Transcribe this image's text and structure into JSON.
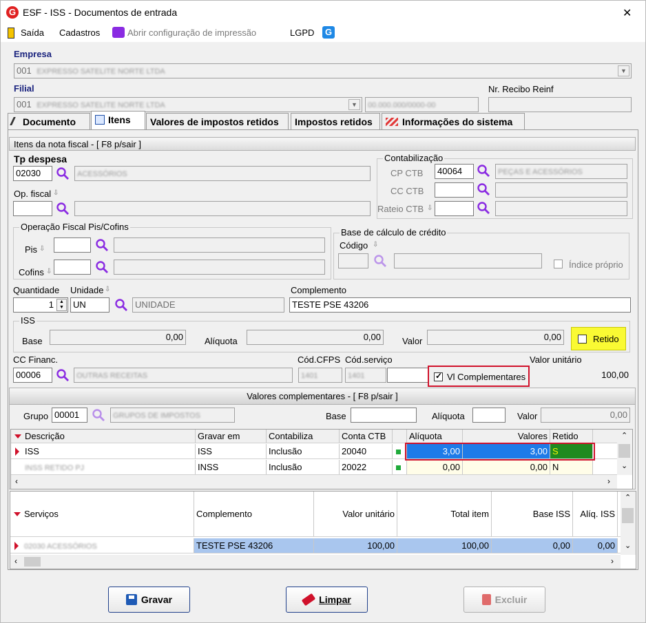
{
  "window": {
    "title": "ESF - ISS - Documentos de entrada",
    "close_glyph": "✕"
  },
  "menu": {
    "saida": "Saída",
    "cadastros": "Cadastros",
    "print_config": "Abrir configuração de impressão",
    "lgpd": "LGPD"
  },
  "header": {
    "empresa_label": "Empresa",
    "empresa_code": "001",
    "empresa_name": "EXPRESSO SATELITE NORTE LTDA",
    "filial_label": "Filial",
    "filial_code": "001",
    "filial_name": "EXPRESSO SATELITE NORTE LTDA",
    "filial_cnpj": "00.000.000/0000-00",
    "recibo_label": "Nr. Recibo Reinf",
    "recibo_value": ""
  },
  "tabs": [
    {
      "label": "Documento"
    },
    {
      "label": "Itens"
    },
    {
      "label": "Valores de impostos retidos"
    },
    {
      "label": "Impostos retidos"
    },
    {
      "label": "Informações do sistema"
    }
  ],
  "itens": {
    "section_title": "Itens da nota fiscal - [ F8 p/sair ]",
    "tp_despesa_label": "Tp despesa",
    "tp_despesa_code": "02030",
    "tp_despesa_desc": "ACESSÓRIOS",
    "op_fiscal_label": "Op. fiscal",
    "op_fiscal_code": "",
    "op_fiscal_desc": "",
    "contabilizacao": {
      "title": "Contabilização",
      "cp_label": "CP CTB",
      "cp_code": "40064",
      "cp_desc": "PEÇAS E ACESSÓRIOS",
      "cc_label": "CC CTB",
      "cc_code": "",
      "rateio_label": "Rateio CTB",
      "rateio_code": ""
    },
    "pis_cofins": {
      "title": "Operação Fiscal Pis/Cofins",
      "pis_label": "Pis",
      "cofins_label": "Cofins"
    },
    "base_credito": {
      "title": "Base de cálculo de crédito",
      "codigo_label": "Código",
      "indice_label": "Índice próprio"
    },
    "quantidade_label": "Quantidade",
    "quantidade_value": "1",
    "unidade_label": "Unidade",
    "unidade_code": "UN",
    "unidade_desc": "UNIDADE",
    "complemento_label": "Complemento",
    "complemento_value": "TESTE PSE 43206",
    "iss": {
      "title": "ISS",
      "base_label": "Base",
      "base_value": "0,00",
      "aliquota_label": "Alíquota",
      "aliquota_value": "0,00",
      "valor_label": "Valor",
      "valor_value": "0,00",
      "retido_label": "Retido"
    },
    "cc_financ_label": "CC Financ.",
    "cc_financ_code": "00006",
    "cc_financ_desc": "OUTRAS RECEITAS",
    "cod_cfps_label": "Cód.CFPS",
    "cod_cfps_value": "1401",
    "cod_servico_label": "Cód.serviço",
    "cod_servico_value": "1401",
    "vl_complementares_label": "Vl Complementares",
    "valor_unitario_label": "Valor unitário",
    "valor_unitario_value": "100,00"
  },
  "complementares": {
    "title": "Valores complementares - [ F8 p/sair ]",
    "grupo_label": "Grupo",
    "grupo_code": "00001",
    "grupo_desc": "GRUPOS DE IMPOSTOS",
    "base_label": "Base",
    "aliquota_label": "Alíquota",
    "valor_label": "Valor",
    "valor_value": "0,00",
    "columns": [
      "Descrição",
      "Gravar em",
      "Contabiliza",
      "Conta CTB",
      "",
      "Alíquota",
      "Valores",
      "Retido"
    ],
    "rows": [
      {
        "descricao": "ISS",
        "gravar": "ISS",
        "contabiliza": "Inclusão",
        "conta": "20040",
        "aliquota": "3,00",
        "valores": "3,00",
        "retido": "S"
      },
      {
        "descricao": "INSS RETIDO PJ",
        "gravar": "INSS",
        "contabiliza": "Inclusão",
        "conta": "20022",
        "aliquota": "0,00",
        "valores": "0,00",
        "retido": "N"
      }
    ]
  },
  "servicos": {
    "columns": [
      "Serviços",
      "Complemento",
      "Valor unitário",
      "Total item",
      "Base ISS",
      "Alíq. ISS"
    ],
    "rows": [
      {
        "servico": "02030 ACESSÓRIOS",
        "complemento": "TESTE PSE 43206",
        "valor_unitario": "100,00",
        "total": "100,00",
        "base_iss": "0,00",
        "aliq_iss": "0,00"
      }
    ]
  },
  "buttons": {
    "gravar": "Gravar",
    "limpar": "Limpar",
    "excluir": "Excluir"
  },
  "colors": {
    "highlight_blue": "#1e7be8",
    "highlight_green": "#1f8a1f",
    "retido_yellow": "#fafa33",
    "red_box": "#d0112b",
    "accent_purple": "#8a2be2"
  }
}
